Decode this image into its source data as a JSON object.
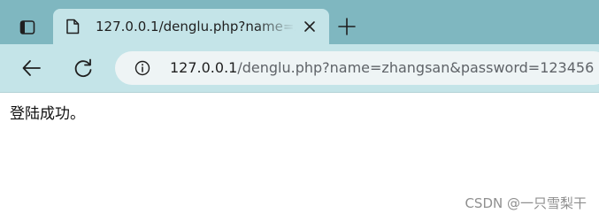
{
  "browser": {
    "tab": {
      "title": "127.0.0.1/denglu.php?name=zhangsan&password=123456"
    },
    "address_bar": {
      "host": "127.0.0.1",
      "path": "/denglu.php?name=zhangsan&password=123456"
    },
    "icons": {
      "tab_actions": "tab-actions-icon",
      "favicon": "document-icon",
      "close": "close-icon",
      "new_tab": "plus-icon",
      "back": "back-arrow-icon",
      "reload": "reload-icon",
      "site_info": "info-icon"
    }
  },
  "page": {
    "message": "登陆成功。",
    "watermark": "CSDN @一只雪梨干"
  },
  "colors": {
    "tab_strip": "#7fb7c0",
    "toolbar": "#c4e4e8",
    "omnibox": "#eef4f5"
  }
}
